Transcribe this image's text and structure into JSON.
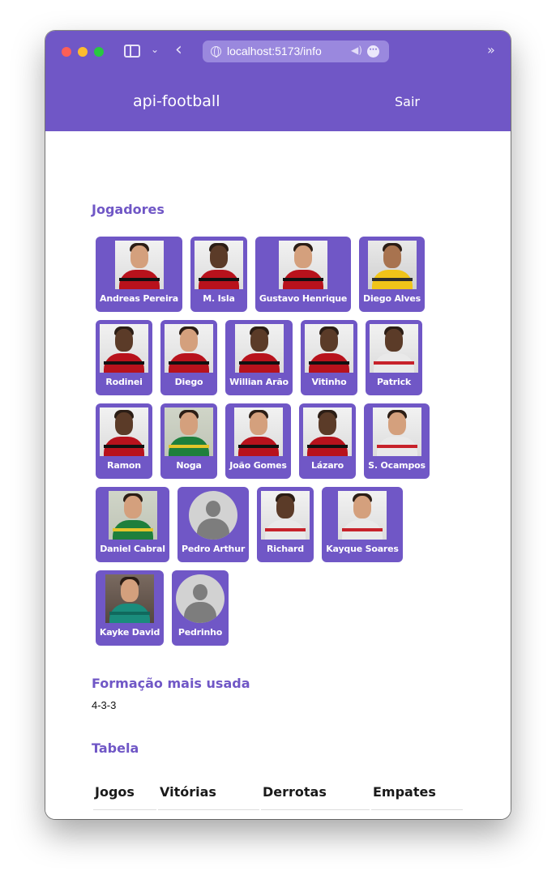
{
  "browser": {
    "url": "localhost:5173/info",
    "icons": [
      "sidebar-icon",
      "chevron-down-icon",
      "back-icon",
      "globe-icon",
      "speaker-icon",
      "more-icon",
      "overflow-icon"
    ]
  },
  "header": {
    "app_title": "api-football",
    "logout_label": "Sair"
  },
  "players_section": {
    "heading": "Jogadores",
    "rows": [
      [
        "Andreas Pereira",
        "M. Isla",
        "Gustavo Henrique",
        "Diego Alves"
      ],
      [
        "Rodinei",
        "Diego",
        "Willian Arão",
        "Vitinho",
        "Patrick"
      ],
      [
        "Ramon",
        "Noga",
        "João Gomes",
        "Lázaro",
        "S. Ocampos"
      ],
      [
        "Daniel Cabral",
        "Pedro Arthur",
        "Richard",
        "Kayque Soares"
      ],
      [
        "Kayke David",
        "Pedrinho"
      ]
    ]
  },
  "formation_section": {
    "heading": "Formação mais usada",
    "value": "4-3-3"
  },
  "table_section": {
    "heading": "Tabela",
    "columns": [
      "Jogos",
      "Vitórias",
      "Derrotas",
      "Empates"
    ]
  },
  "colors": {
    "accent": "#7057c6",
    "url_bar": "#9a88de"
  }
}
